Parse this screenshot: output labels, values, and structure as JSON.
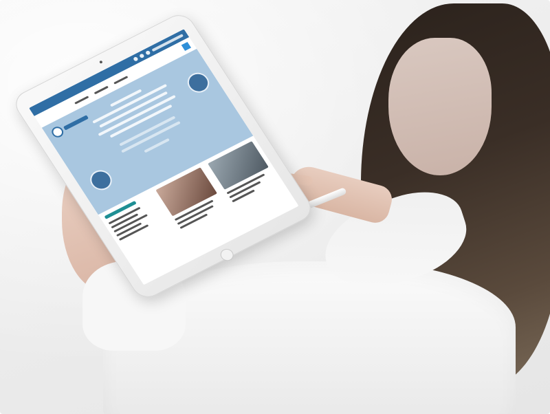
{
  "photo": {
    "subject": "",
    "colors": {
      "background": "#eeeeee",
      "site_blue": "#2f6ea5",
      "hero_blue": "#a9c7e0",
      "accent_teal": "#1f8f94",
      "shirt": "#f5f5f5"
    }
  },
  "screen": {
    "icons": [
      "social-icon",
      "social-icon",
      "social-icon",
      "search-icon"
    ]
  }
}
